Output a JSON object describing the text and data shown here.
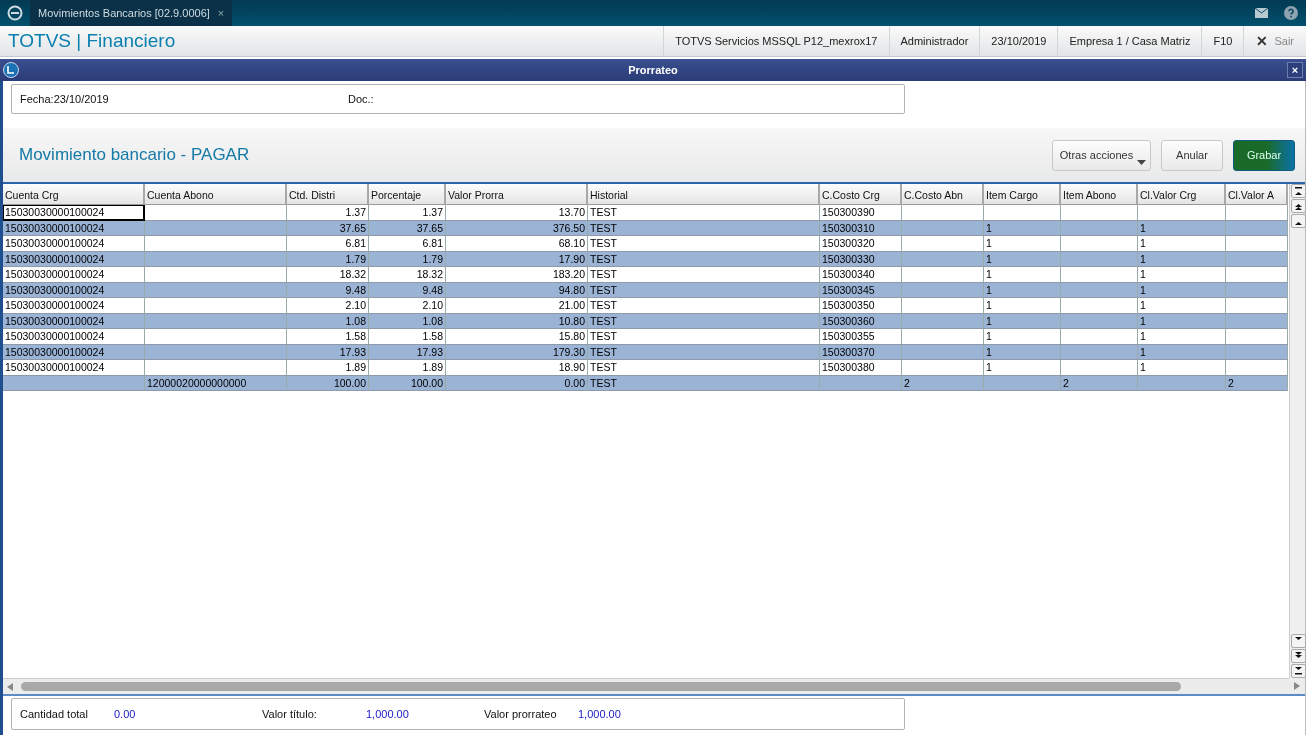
{
  "tab_bar": {
    "tab": {
      "label": "Movimientos Bancarios [02.9.0006]",
      "close": "×",
      "selected": true
    }
  },
  "header": {
    "app_title": "TOTVS | Financiero",
    "info": [
      "TOTVS Servicios MSSQL P12_mexrox17",
      "Administrador",
      "23/10/2019",
      "Empresa 1 / Casa Matriz",
      "F10"
    ],
    "exit": {
      "icon": "✕",
      "label": "Sair"
    }
  },
  "dialog": {
    "title": "Prorrateo",
    "close": "×"
  },
  "fields": {
    "fecha": "Fecha:23/10/2019",
    "doc": "Doc.:"
  },
  "section_title": "Movimiento bancario - PAGAR",
  "buttons": [
    {
      "label": "Otras acciones",
      "kind": "menu"
    },
    {
      "label": "Anular",
      "kind": "plain"
    },
    {
      "label": "Grabar",
      "kind": "primary"
    }
  ],
  "table": {
    "columns": [
      "Cuenta Crg",
      "Cuenta Abono",
      "Ctd. Distri",
      "Porcentaje",
      "Valor Prorra",
      "Historial",
      "C.Costo Crg",
      "C.Costo Abn",
      "Item Cargo",
      "Item Abono",
      "Cl.Valor Crg",
      "Cl.Valor A"
    ],
    "rows": [
      {
        "focused": true,
        "cells": [
          "15030030000100024",
          null,
          "1.37",
          "1.37",
          "13.70",
          "TEST",
          "150300390",
          null,
          null,
          null,
          null,
          null
        ]
      },
      {
        "focused": false,
        "cells": [
          "15030030000100024",
          null,
          "37.65",
          "37.65",
          "376.50",
          "TEST",
          "150300310",
          null,
          "1",
          null,
          "1",
          null
        ]
      },
      {
        "focused": false,
        "cells": [
          "15030030000100024",
          null,
          "6.81",
          "6.81",
          "68.10",
          "TEST",
          "150300320",
          null,
          "1",
          null,
          "1",
          null
        ]
      },
      {
        "focused": false,
        "cells": [
          "15030030000100024",
          null,
          "1.79",
          "1.79",
          "17.90",
          "TEST",
          "150300330",
          null,
          "1",
          null,
          "1",
          null
        ]
      },
      {
        "focused": false,
        "cells": [
          "15030030000100024",
          null,
          "18.32",
          "18.32",
          "183.20",
          "TEST",
          "150300340",
          null,
          "1",
          null,
          "1",
          null
        ]
      },
      {
        "focused": false,
        "cells": [
          "15030030000100024",
          null,
          "9.48",
          "9.48",
          "94.80",
          "TEST",
          "150300345",
          null,
          "1",
          null,
          "1",
          null
        ]
      },
      {
        "focused": false,
        "cells": [
          "15030030000100024",
          null,
          "2.10",
          "2.10",
          "21.00",
          "TEST",
          "150300350",
          null,
          "1",
          null,
          "1",
          null
        ]
      },
      {
        "focused": false,
        "cells": [
          "15030030000100024",
          null,
          "1.08",
          "1.08",
          "10.80",
          "TEST",
          "150300360",
          null,
          "1",
          null,
          "1",
          null
        ]
      },
      {
        "focused": false,
        "cells": [
          "15030030000100024",
          null,
          "1.58",
          "1.58",
          "15.80",
          "TEST",
          "150300355",
          null,
          "1",
          null,
          "1",
          null
        ]
      },
      {
        "focused": false,
        "cells": [
          "15030030000100024",
          null,
          "17.93",
          "17.93",
          "179.30",
          "TEST",
          "150300370",
          null,
          "1",
          null,
          "1",
          null
        ]
      },
      {
        "focused": false,
        "cells": [
          "15030030000100024",
          null,
          "1.89",
          "1.89",
          "18.90",
          "TEST",
          "150300380",
          null,
          "1",
          null,
          "1",
          null
        ]
      },
      {
        "focused": false,
        "cells": [
          null,
          "12000020000000000",
          "100.00",
          "100.00",
          "0.00",
          "TEST",
          null,
          "2",
          null,
          "2",
          null,
          "2"
        ]
      }
    ]
  },
  "totals": [
    {
      "label": "Cantidad total",
      "value": "0.00"
    },
    {
      "label": "Valor título:",
      "value": "1,000.00"
    },
    {
      "label": "Valor prorrateo",
      "value": "1,000.00"
    }
  ]
}
